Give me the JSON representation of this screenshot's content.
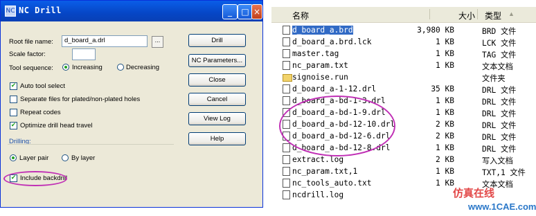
{
  "dialog": {
    "title": "NC Drill",
    "title_icon": "NC",
    "window_buttons": {
      "minimize": "_",
      "maximize": "□",
      "close": "×"
    },
    "root_file_label": "Root file name:",
    "root_file_value": "d_board_a.drl",
    "browse_label": "...",
    "scale_label": "Scale factor:",
    "scale_value": "",
    "tool_seq_label": "Tool sequence:",
    "increasing": "Increasing",
    "decreasing": "Decreasing",
    "auto_tool": "Auto tool select",
    "separate_files": "Separate files for plated/non-plated holes",
    "repeat_codes": "Repeat codes",
    "optimize": "Optimize drill head travel",
    "drilling_label": "Drilling:",
    "layer_pair": "Layer pair",
    "by_layer": "By layer",
    "include_backdrill": "Include backdrill",
    "buttons": {
      "drill": "Drill",
      "nc_params": "NC Parameters...",
      "close": "Close",
      "cancel": "Cancel",
      "view_log": "View Log",
      "help": "Help"
    },
    "checked_mark": "✔"
  },
  "explorer": {
    "headers": {
      "name": "名称",
      "size": "大小",
      "type": "类型",
      "sort_icon": "▲"
    },
    "files": [
      {
        "name": "d_board_a.brd",
        "size": "3,980 KB",
        "type": "BRD 文件",
        "icon": "file-icon",
        "selected": true
      },
      {
        "name": "d_board_a.brd.lck",
        "size": "1 KB",
        "type": "LCK 文件",
        "icon": "file-icon"
      },
      {
        "name": "master.tag",
        "size": "1 KB",
        "type": "TAG 文件",
        "icon": "file-icon"
      },
      {
        "name": "nc_param.txt",
        "size": "1 KB",
        "type": "文本文档",
        "icon": "file-icon"
      },
      {
        "name": "signoise.run",
        "size": "",
        "type": "文件夹",
        "icon": "folder-icon"
      },
      {
        "name": "d_board_a-1-12.drl",
        "size": "35 KB",
        "type": "DRL 文件",
        "icon": "file-icon"
      },
      {
        "name": "d_board_a-bd-1-3.drl",
        "size": "1 KB",
        "type": "DRL 文件",
        "icon": "file-icon"
      },
      {
        "name": "d_board_a-bd-1-9.drl",
        "size": "1 KB",
        "type": "DRL 文件",
        "icon": "file-icon"
      },
      {
        "name": "d_board_a-bd-12-10.drl",
        "size": "2 KB",
        "type": "DRL 文件",
        "icon": "file-icon"
      },
      {
        "name": "d_board_a-bd-12-6.drl",
        "size": "2 KB",
        "type": "DRL 文件",
        "icon": "file-icon"
      },
      {
        "name": "d_board_a-bd-12-8.drl",
        "size": "1 KB",
        "type": "DRL 文件",
        "icon": "file-icon"
      },
      {
        "name": "extract.log",
        "size": "2 KB",
        "type": "写入文档",
        "icon": "file-icon"
      },
      {
        "name": "nc_param.txt,1",
        "size": "1 KB",
        "type": "TXT,1 文件",
        "icon": "file-icon"
      },
      {
        "name": "nc_tools_auto.txt",
        "size": "1 KB",
        "type": "文本文档",
        "icon": "file-icon"
      },
      {
        "name": "ncdrill.log",
        "size": "",
        "type": "",
        "icon": "file-icon"
      }
    ]
  },
  "watermark": {
    "text1": "仿真在线",
    "text2": "www.1CAE.com"
  }
}
